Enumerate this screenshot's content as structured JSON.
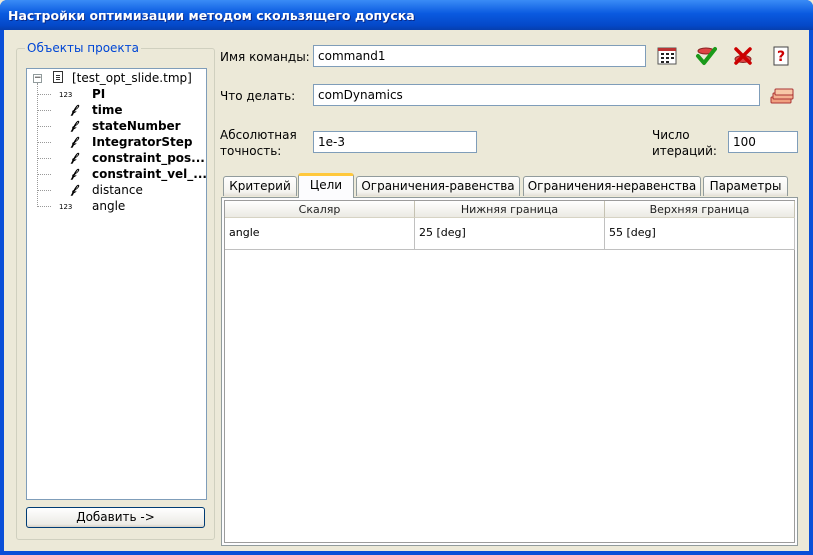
{
  "window": {
    "title": "Настройки оптимизации методом скользящего допуска"
  },
  "project_objects": {
    "legend": "Объекты проекта",
    "root_label": "[test_opt_slide.tmp]",
    "root_expander": "−",
    "items": [
      {
        "label": "PI",
        "bold": true,
        "icon": "numeric-123-icon"
      },
      {
        "label": "time",
        "bold": true,
        "icon": "script-function-icon"
      },
      {
        "label": "stateNumber",
        "bold": true,
        "icon": "script-function-icon"
      },
      {
        "label": "IntegratorStep",
        "bold": true,
        "icon": "script-function-icon"
      },
      {
        "label": "constraint_pos...",
        "bold": true,
        "icon": "script-function-icon"
      },
      {
        "label": "constraint_vel_...",
        "bold": true,
        "icon": "script-function-icon"
      },
      {
        "label": "distance",
        "bold": false,
        "icon": "script-function-icon"
      },
      {
        "label": "angle",
        "bold": false,
        "icon": "numeric-123-icon"
      }
    ],
    "icon_numeric_text": "123",
    "add_button_label": "Добавить ->"
  },
  "command": {
    "name_label": "Имя команды:",
    "name_value": "command1",
    "action_label": "Что делать:",
    "action_value": "comDynamics"
  },
  "accuracy": {
    "label_line1": "Абсолютная",
    "label_line2": "точность:",
    "value": "1e-3"
  },
  "iterations": {
    "label_line1": "Число",
    "label_line2": "итераций:",
    "value": "100"
  },
  "toolbar_icons": [
    "grid-calc-icon",
    "checkmark-accept-icon",
    "x-delete-icon",
    "help-document-icon",
    "stacked-layers-icon"
  ],
  "tabs": [
    {
      "label": "Критерий"
    },
    {
      "label": "Цели",
      "active": true
    },
    {
      "label": "Ограничения-равенства"
    },
    {
      "label": "Ограничения-неравенства"
    },
    {
      "label": "Параметры"
    }
  ],
  "goals_table": {
    "headers": [
      "Скаляр",
      "Нижняя граница",
      "Верхняя граница"
    ],
    "rows": [
      [
        "angle",
        "25 [deg]",
        "55 [deg]"
      ]
    ]
  },
  "colors": {
    "title_bar": "#0a5ae0",
    "dialog_bg": "#ece9d8",
    "group_legend": "#0046d5",
    "active_tab_accent": "#ffc83c"
  }
}
